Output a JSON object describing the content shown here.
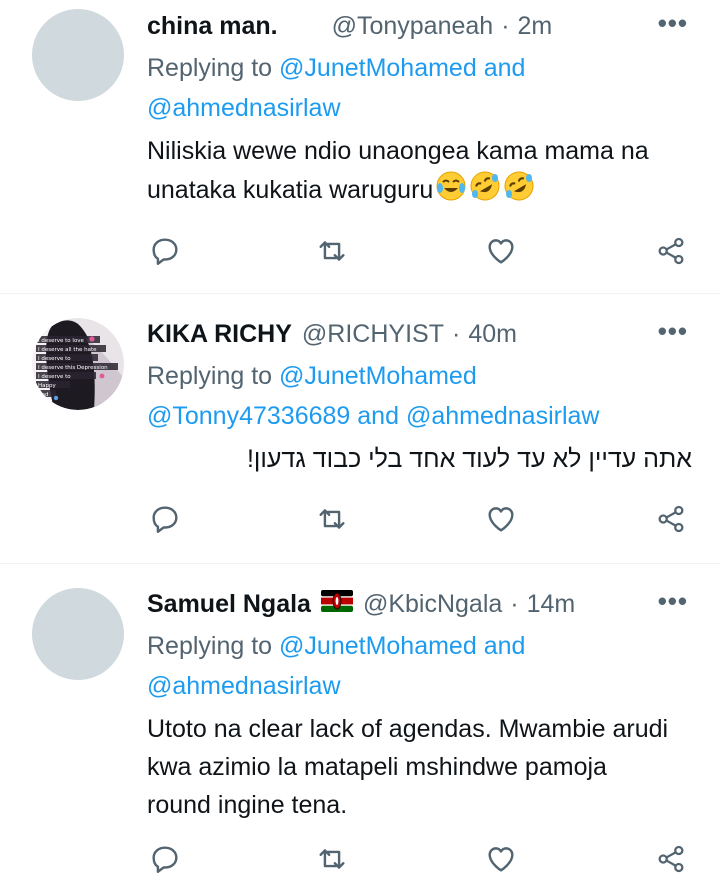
{
  "tweets": [
    {
      "name": "china man.",
      "handle": "@Tonypaneah",
      "dot": "·",
      "time": "2m",
      "more": "•••",
      "replying_prefix": "Replying to",
      "mention_1": "@JunetMohamed",
      "connector": "and",
      "mention_2": "@ahmednasirlaw",
      "text": "Niliskia wewe ndio unaongea kama mama na unataka kukatia waruguru",
      "emojis": [
        "face-with-tears-of-joy",
        "rolling-on-floor-laughing",
        "rolling-on-floor-laughing"
      ]
    },
    {
      "name": "KIKA RICHY",
      "handle": "@RICHYIST",
      "dot": "·",
      "time": "40m",
      "more": "•••",
      "replying_prefix": "Replying to",
      "mention_1": "@JunetMohamed",
      "mention_2": "@Tonny47336689",
      "connector": "and",
      "mention_3": "@ahmednasirlaw",
      "text": "אתה עדיין לא עד לעוד אחד בלי כבוד גדעון!",
      "avatar_text": [
        "I deserve to love",
        "I deserve all the hate",
        "I deserve to",
        "I deserve this Depression",
        "I deserve to",
        "Happy",
        "End"
      ]
    },
    {
      "name": "Samuel Ngala",
      "flag": "kenya-flag",
      "handle": "@KbicNgala",
      "dot": "·",
      "time": "14m",
      "more": "•••",
      "replying_prefix": "Replying to",
      "mention_1": "@JunetMohamed",
      "connector": "and",
      "mention_2": "@ahmednasirlaw",
      "text": "Utoto na clear lack of agendas. Mwambie arudi kwa azimio la matapeli mshindwe pamoja round ingine tena."
    }
  ],
  "action_icons": [
    "reply-icon",
    "retweet-icon",
    "like-icon",
    "share-icon"
  ],
  "colors": {
    "link": "#1d9bf0",
    "muted": "#536471",
    "text": "#0f1419",
    "avatar_placeholder": "#cfd9de",
    "divider": "#eff3f4"
  }
}
